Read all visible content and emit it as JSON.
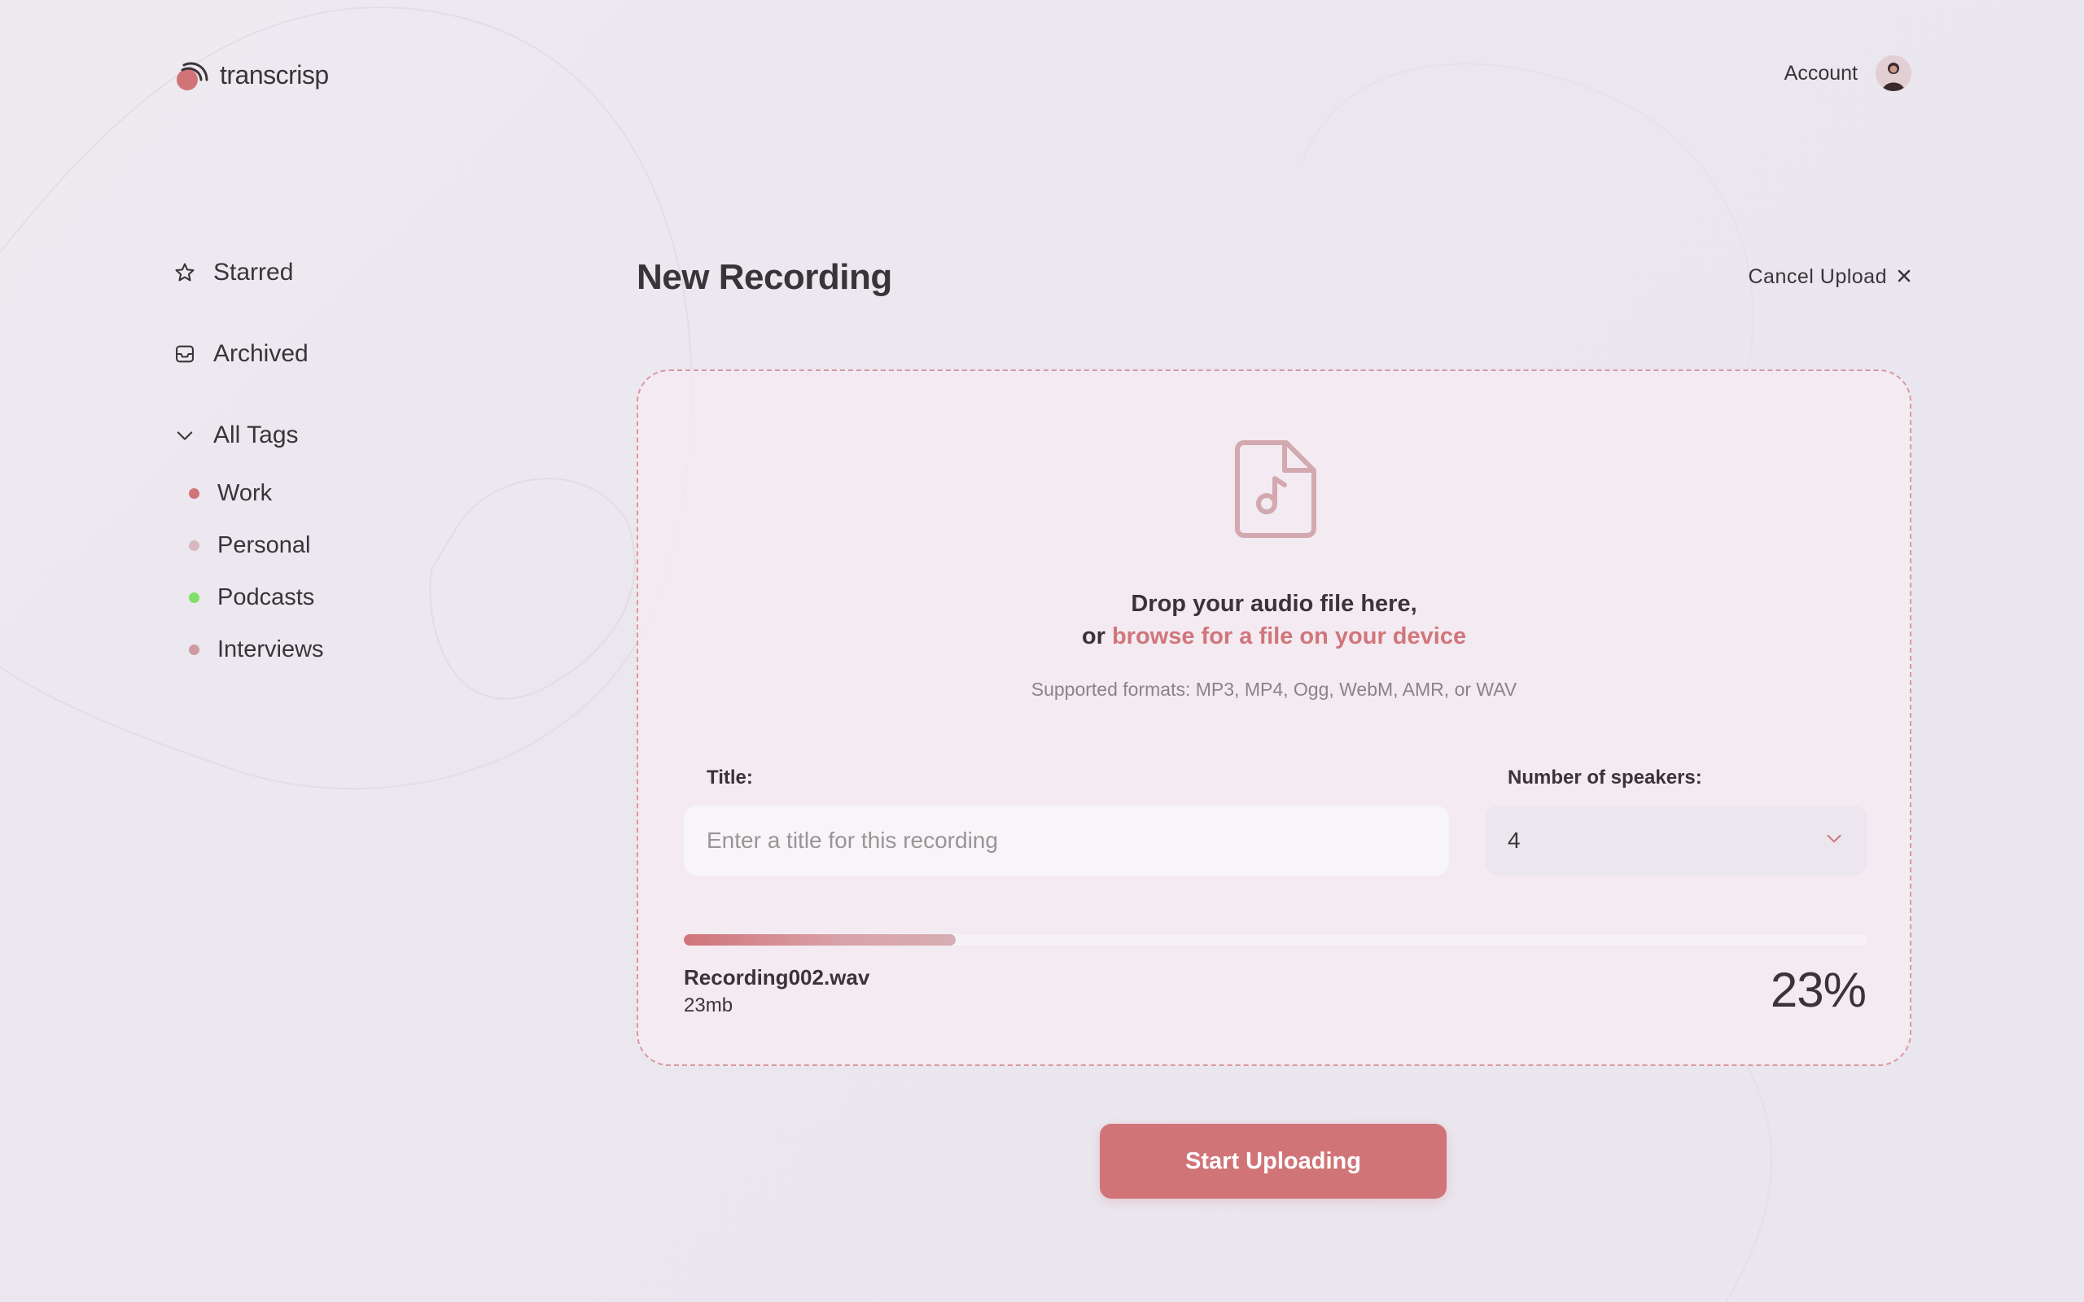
{
  "header": {
    "logo_text": "transcrisp",
    "account_label": "Account"
  },
  "sidebar": {
    "items": [
      {
        "label": "Starred",
        "icon": "star-icon"
      },
      {
        "label": "Archived",
        "icon": "inbox-icon"
      },
      {
        "label": "All Tags",
        "icon": "chevron-down-icon"
      }
    ],
    "tags": [
      {
        "label": "Work",
        "color": "#d07478"
      },
      {
        "label": "Personal",
        "color": "#d8b8be"
      },
      {
        "label": "Podcasts",
        "color": "#7fe06a"
      },
      {
        "label": "Interviews",
        "color": "#cf9aa2"
      }
    ]
  },
  "main": {
    "title": "New Recording",
    "cancel_label": "Cancel Upload",
    "drop_line1": "Drop your audio file here,",
    "drop_or": "or",
    "drop_link": "browse for a file on your device",
    "formats": "Supported formats: MP3, MP4, Ogg, WebM, AMR, or WAV",
    "title_label": "Title:",
    "title_placeholder": "Enter a title for this recording",
    "title_value": "",
    "speakers_label": "Number of speakers:",
    "speakers_value": "4",
    "file_name": "Recording002.wav",
    "file_size": "23mb",
    "progress_percent": 23,
    "progress_label": "23%",
    "start_button": "Start Uploading"
  },
  "colors": {
    "accent": "#d07478",
    "text": "#3a3438"
  }
}
